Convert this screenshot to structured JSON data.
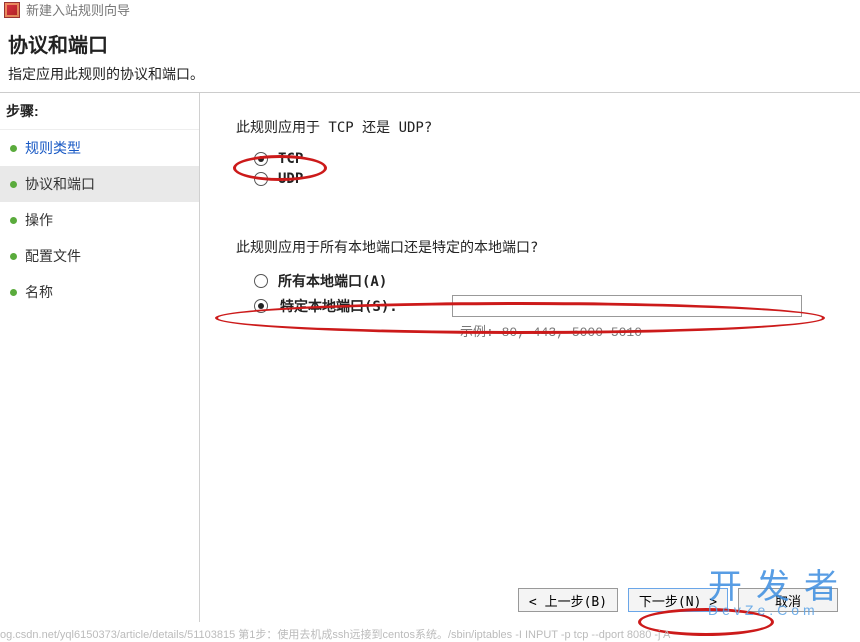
{
  "window": {
    "title": "新建入站规则向导"
  },
  "header": {
    "title": "协议和端口",
    "subtitle": "指定应用此规则的协议和端口。"
  },
  "sidebar": {
    "steps_label": "步骤:",
    "items": [
      {
        "label": "规则类型"
      },
      {
        "label": "协议和端口"
      },
      {
        "label": "操作"
      },
      {
        "label": "配置文件"
      },
      {
        "label": "名称"
      }
    ]
  },
  "main": {
    "protocol_question": "此规则应用于 TCP 还是 UDP?",
    "tcp_label": "TCP",
    "udp_label": "UDP",
    "port_question": "此规则应用于所有本地端口还是特定的本地端口?",
    "all_ports_label": "所有本地端口(A)",
    "specific_ports_label": "特定本地端口(S):",
    "port_value": "",
    "example_label": "示例: 80, 443, 5000-5010"
  },
  "buttons": {
    "back": "< 上一步(B)",
    "next": "下一步(N) >",
    "cancel": "取消"
  },
  "watermark": {
    "main": "开发者",
    "sub": "DevZe.Com"
  },
  "footer_ghost": "og.csdn.net/yql6150373/article/details/51103815 第1步：使用去机成ssh远接到centos系统。/sbin/iptables -I INPUT -p tcp --dport 8080 -j A"
}
